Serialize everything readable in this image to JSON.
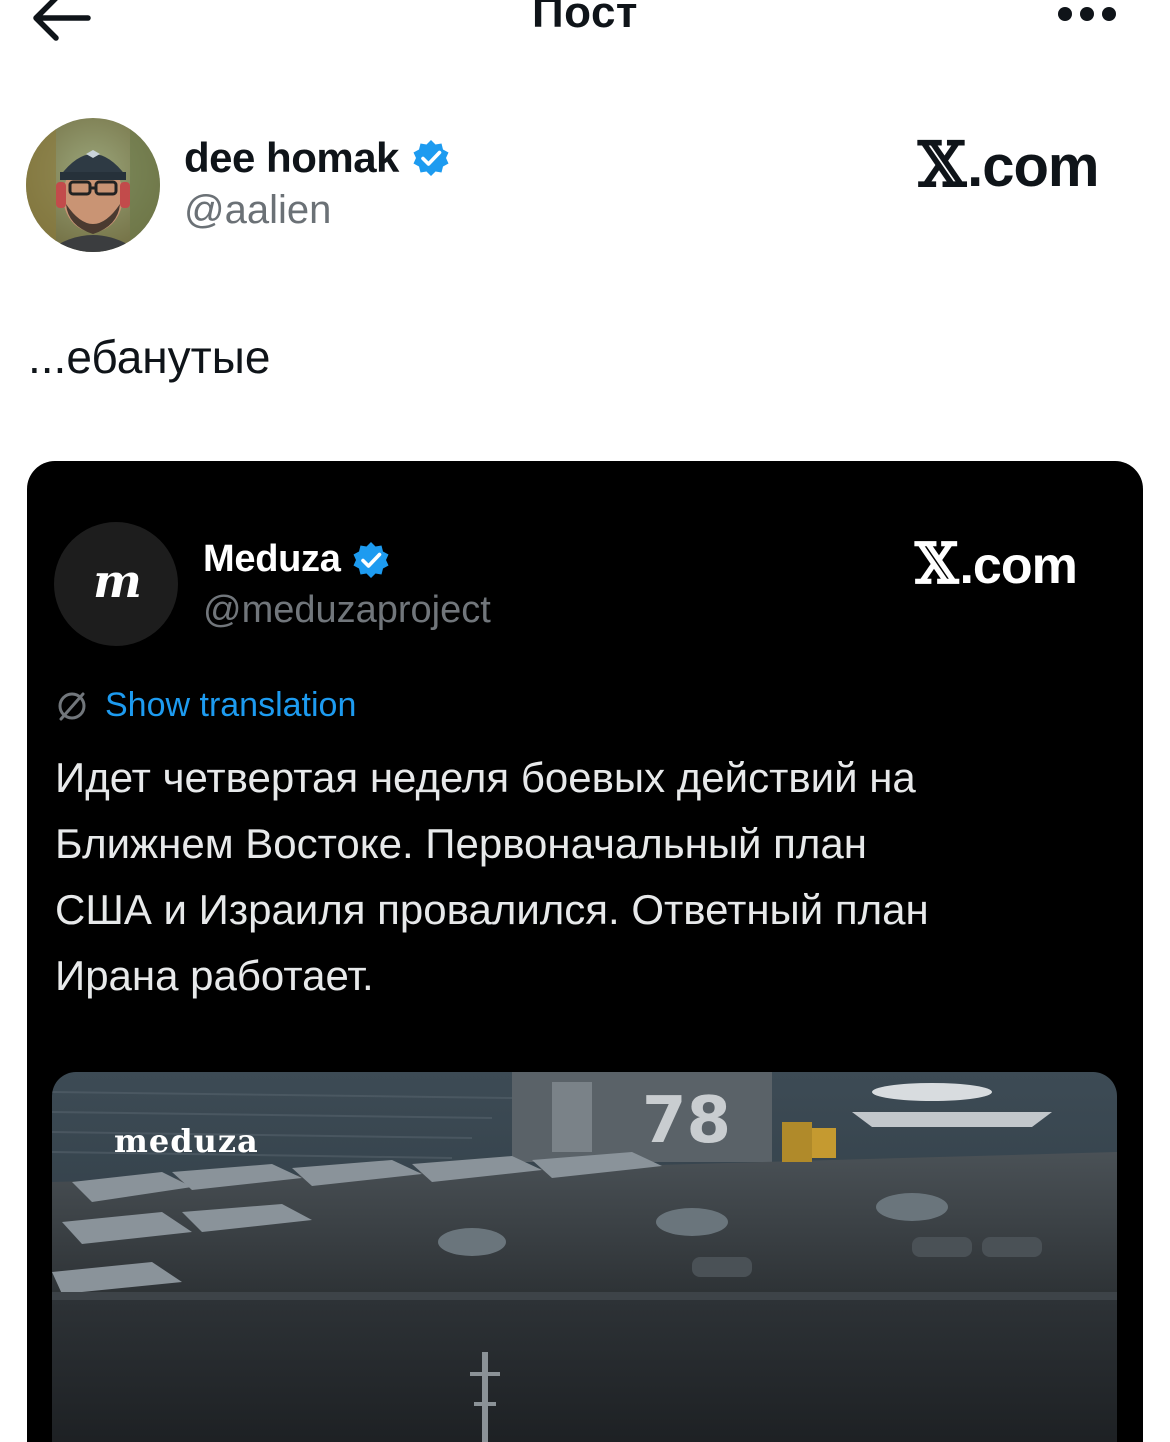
{
  "header": {
    "title": "Пост"
  },
  "post": {
    "author_name": "dee homak",
    "author_handle": "@aalien",
    "brand_text": "com",
    "text": "...ебанутые"
  },
  "embedded": {
    "avatar_letter": "m",
    "author_name": "Meduza",
    "author_handle": "@meduzaproject",
    "brand_text": "com",
    "translate_label": "Show translation",
    "lines": [
      "Идет четвертая неделя боевых действий на",
      "Ближнем Востоке. Первоначальный план",
      "США и Израиля провалился. Ответный план",
      "Ирана работает."
    ],
    "media_logo": "meduza"
  },
  "colors": {
    "verified": "#1d9bf0",
    "link": "#1d9bf0",
    "card_bg": "#000000"
  },
  "icons": [
    "back-arrow-icon",
    "more-dots-icon",
    "verified-badge-icon",
    "x-logo-icon",
    "translate-globe-icon"
  ]
}
